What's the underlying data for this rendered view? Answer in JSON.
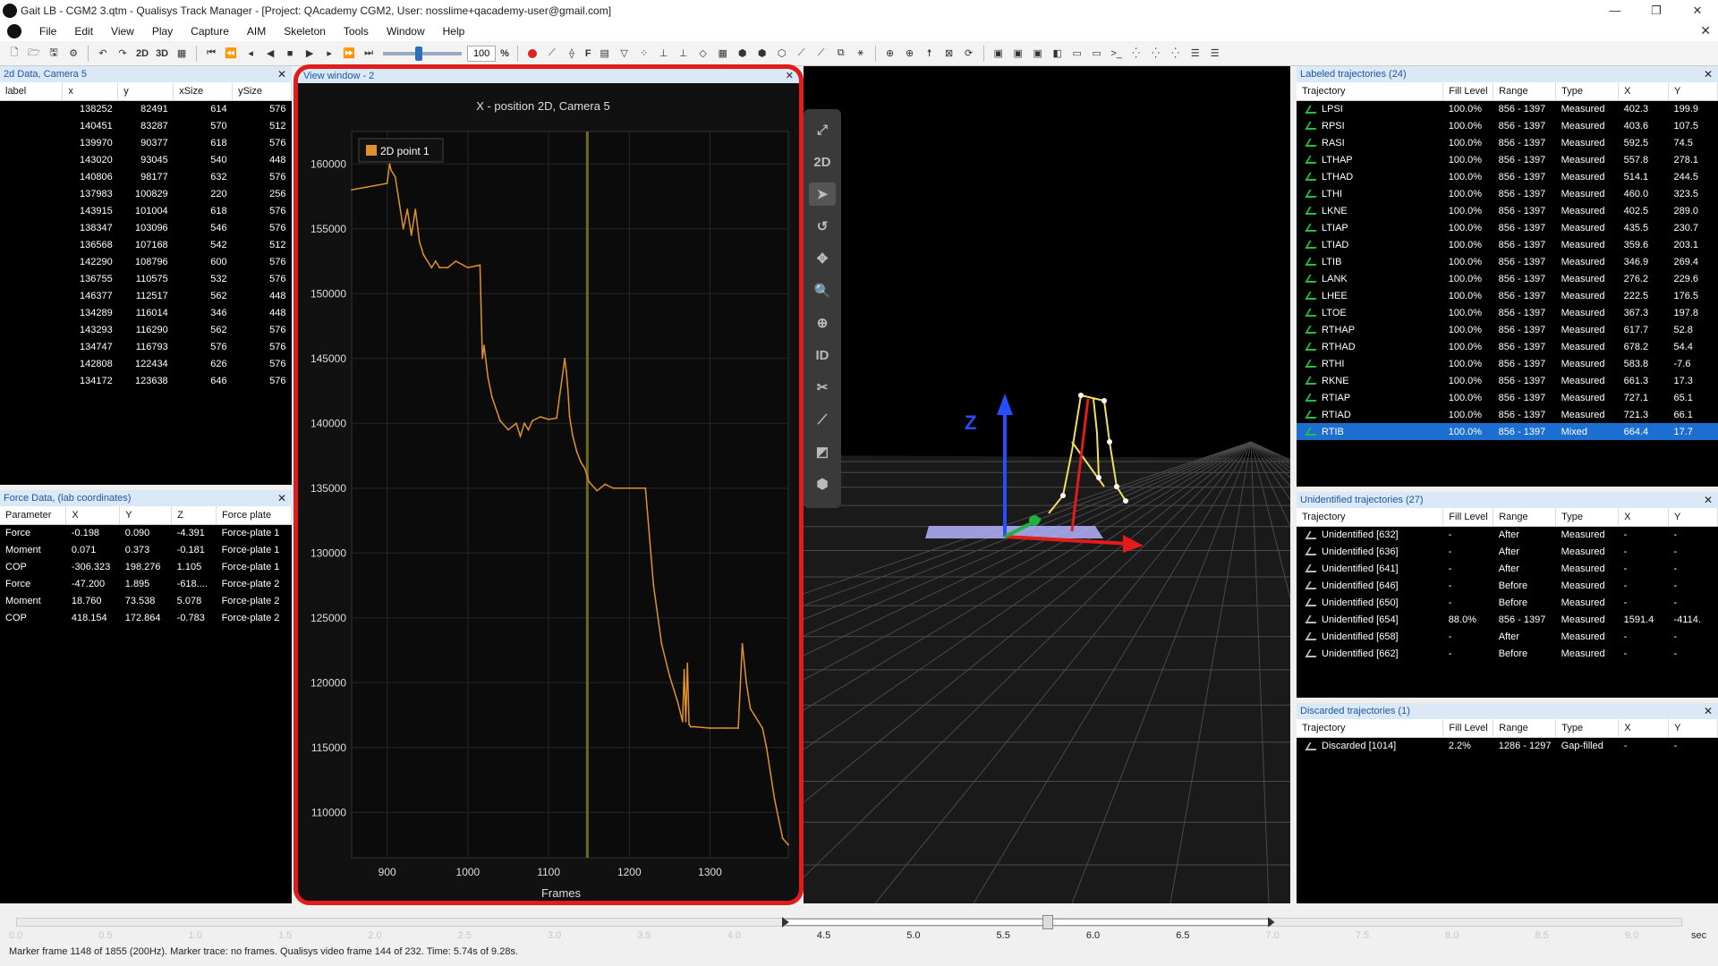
{
  "title": "Gait LB - CGM2 3.qtm - Qualisys Track Manager - [Project: QAcademy CGM2, User: nosslime+qacademy-user@gmail.com]",
  "menu": [
    "File",
    "Edit",
    "View",
    "Play",
    "Capture",
    "AIM",
    "Skeleton",
    "Tools",
    "Window",
    "Help"
  ],
  "toolbar": {
    "btn_2d": "2D",
    "btn_3d": "3D",
    "speed": "100",
    "percent": "%",
    "btn_f": "F"
  },
  "data2d": {
    "title": "2d Data, Camera 5",
    "columns": [
      "label",
      "x",
      "y",
      "xSize",
      "ySize"
    ],
    "rows": [
      [
        "",
        "138252",
        "82491",
        "614",
        "576"
      ],
      [
        "",
        "140451",
        "83287",
        "570",
        "512"
      ],
      [
        "",
        "139970",
        "90377",
        "618",
        "576"
      ],
      [
        "",
        "143020",
        "93045",
        "540",
        "448"
      ],
      [
        "",
        "140806",
        "98177",
        "632",
        "576"
      ],
      [
        "",
        "137983",
        "100829",
        "220",
        "256"
      ],
      [
        "",
        "143915",
        "101004",
        "618",
        "576"
      ],
      [
        "",
        "138347",
        "103096",
        "546",
        "576"
      ],
      [
        "",
        "136568",
        "107168",
        "542",
        "512"
      ],
      [
        "",
        "142290",
        "108796",
        "600",
        "576"
      ],
      [
        "",
        "136755",
        "110575",
        "532",
        "576"
      ],
      [
        "",
        "146377",
        "112517",
        "562",
        "448"
      ],
      [
        "",
        "134289",
        "116014",
        "346",
        "448"
      ],
      [
        "",
        "143293",
        "116290",
        "562",
        "576"
      ],
      [
        "",
        "134747",
        "116793",
        "576",
        "576"
      ],
      [
        "",
        "142808",
        "122434",
        "626",
        "576"
      ],
      [
        "",
        "134172",
        "123638",
        "646",
        "576"
      ]
    ]
  },
  "force": {
    "title": "Force Data,  (lab coordinates)",
    "columns": [
      "Parameter",
      "X",
      "Y",
      "Z",
      "Force plate"
    ],
    "rows": [
      [
        "Force",
        "-0.198",
        "0.090",
        "-4.391",
        "Force-plate 1"
      ],
      [
        "Moment",
        "0.071",
        "0.373",
        "-0.181",
        "Force-plate 1"
      ],
      [
        "COP",
        "-306.323",
        "198.276",
        "1.105",
        "Force-plate 1"
      ],
      [
        "Force",
        "-47.200",
        "1.895",
        "-618....",
        "Force-plate 2"
      ],
      [
        "Moment",
        "18.760",
        "73.538",
        "5.078",
        "Force-plate 2"
      ],
      [
        "COP",
        "418.154",
        "172.864",
        "-0.783",
        "Force-plate 2"
      ]
    ]
  },
  "graph_window": {
    "title": "View window - 2"
  },
  "chart_data": {
    "type": "line",
    "title": "X - position 2D, Camera 5",
    "xlabel": "Frames",
    "ylabel": "",
    "xlim": [
      856,
      1397
    ],
    "ylim": [
      106500,
      162500
    ],
    "xticks": [
      900,
      1000,
      1100,
      1200,
      1300
    ],
    "yticks": [
      110000,
      115000,
      120000,
      125000,
      130000,
      135000,
      140000,
      145000,
      150000,
      155000,
      160000
    ],
    "cursor_frame": 1148,
    "grid": true,
    "legend_position": "top-left",
    "series": [
      {
        "name": "2D point 1",
        "color": "#e0922a",
        "x": [
          856,
          900,
          903,
          905,
          910,
          915,
          920,
          925,
          930,
          935,
          940,
          945,
          950,
          955,
          960,
          965,
          975,
          985,
          1000,
          1015,
          1018,
          1020,
          1025,
          1030,
          1040,
          1050,
          1060,
          1065,
          1070,
          1075,
          1080,
          1090,
          1100,
          1110,
          1120,
          1122,
          1124,
          1126,
          1130,
          1135,
          1140,
          1145,
          1150,
          1160,
          1170,
          1180,
          1200,
          1220,
          1230,
          1240,
          1250,
          1260,
          1266,
          1268,
          1270,
          1272,
          1274,
          1276,
          1280,
          1300,
          1320,
          1335,
          1340,
          1345,
          1350,
          1355,
          1360,
          1365,
          1370,
          1375,
          1380,
          1385,
          1390,
          1397
        ],
        "y": [
          158000,
          158500,
          160000,
          159500,
          159000,
          157000,
          155000,
          156500,
          154500,
          156500,
          154000,
          153000,
          152500,
          152000,
          152500,
          152000,
          152000,
          152500,
          152000,
          152200,
          145000,
          146000,
          143500,
          142000,
          140200,
          139500,
          140000,
          139000,
          140000,
          139500,
          140200,
          140500,
          140300,
          140400,
          145000,
          144000,
          142500,
          140500,
          139000,
          137800,
          137000,
          136500,
          135500,
          134800,
          135300,
          135000,
          135000,
          135000,
          127500,
          123000,
          120500,
          118500,
          117000,
          121000,
          117000,
          121500,
          116800,
          116600,
          116600,
          116500,
          116500,
          116500,
          123000,
          120000,
          118000,
          117500,
          117000,
          116500,
          115000,
          113000,
          111000,
          109500,
          108000,
          107500
        ]
      }
    ]
  },
  "tools": [
    "2D",
    "ID"
  ],
  "view3d": {
    "axis_label": "Z"
  },
  "labeled": {
    "title": "Labeled trajectories (24)",
    "columns": [
      "Trajectory",
      "Fill Level",
      "Range",
      "Type",
      "X",
      "Y"
    ],
    "rows": [
      [
        "LPSI",
        "100.0%",
        "856 - 1397",
        "Measured",
        "402.3",
        "199.9"
      ],
      [
        "RPSI",
        "100.0%",
        "856 - 1397",
        "Measured",
        "403.6",
        "107.5"
      ],
      [
        "RASI",
        "100.0%",
        "856 - 1397",
        "Measured",
        "592.5",
        "74.5"
      ],
      [
        "LTHAP",
        "100.0%",
        "856 - 1397",
        "Measured",
        "557.8",
        "278.1"
      ],
      [
        "LTHAD",
        "100.0%",
        "856 - 1397",
        "Measured",
        "514.1",
        "244.5"
      ],
      [
        "LTHI",
        "100.0%",
        "856 - 1397",
        "Measured",
        "460.0",
        "323.5"
      ],
      [
        "LKNE",
        "100.0%",
        "856 - 1397",
        "Measured",
        "402.5",
        "289.0"
      ],
      [
        "LTIAP",
        "100.0%",
        "856 - 1397",
        "Measured",
        "435.5",
        "230.7"
      ],
      [
        "LTIAD",
        "100.0%",
        "856 - 1397",
        "Measured",
        "359.6",
        "203.1"
      ],
      [
        "LTIB",
        "100.0%",
        "856 - 1397",
        "Measured",
        "346.9",
        "269.4"
      ],
      [
        "LANK",
        "100.0%",
        "856 - 1397",
        "Measured",
        "276.2",
        "229.6"
      ],
      [
        "LHEE",
        "100.0%",
        "856 - 1397",
        "Measured",
        "222.5",
        "176.5"
      ],
      [
        "LTOE",
        "100.0%",
        "856 - 1397",
        "Measured",
        "367.3",
        "197.8"
      ],
      [
        "RTHAP",
        "100.0%",
        "856 - 1397",
        "Measured",
        "617.7",
        "52.8"
      ],
      [
        "RTHAD",
        "100.0%",
        "856 - 1397",
        "Measured",
        "678.2",
        "54.4"
      ],
      [
        "RTHI",
        "100.0%",
        "856 - 1397",
        "Measured",
        "583.8",
        "-7.6"
      ],
      [
        "RKNE",
        "100.0%",
        "856 - 1397",
        "Measured",
        "661.3",
        "17.3"
      ],
      [
        "RTIAP",
        "100.0%",
        "856 - 1397",
        "Measured",
        "727.1",
        "65.1"
      ],
      [
        "RTIAD",
        "100.0%",
        "856 - 1397",
        "Measured",
        "721.3",
        "66.1"
      ],
      [
        "RTIB",
        "100.0%",
        "856 - 1397",
        "Mixed",
        "664.4",
        "17.7"
      ]
    ]
  },
  "unidentified": {
    "title": "Unidentified trajectories (27)",
    "columns": [
      "Trajectory",
      "Fill Level",
      "Range",
      "Type",
      "X",
      "Y"
    ],
    "rows": [
      [
        "Unidentified [632]",
        "-",
        "After",
        "Measured",
        "-",
        "-"
      ],
      [
        "Unidentified [636]",
        "-",
        "After",
        "Measured",
        "-",
        "-"
      ],
      [
        "Unidentified [641]",
        "-",
        "After",
        "Measured",
        "-",
        "-"
      ],
      [
        "Unidentified [646]",
        "-",
        "Before",
        "Measured",
        "-",
        "-"
      ],
      [
        "Unidentified [650]",
        "-",
        "Before",
        "Measured",
        "-",
        "-"
      ],
      [
        "Unidentified [654]",
        "88.0%",
        "856 - 1397",
        "Measured",
        "1591.4",
        "-4114."
      ],
      [
        "Unidentified [658]",
        "-",
        "After",
        "Measured",
        "-",
        "-"
      ],
      [
        "Unidentified [662]",
        "-",
        "Before",
        "Measured",
        "-",
        "-"
      ]
    ]
  },
  "discarded": {
    "title": "Discarded trajectories (1)",
    "columns": [
      "Trajectory",
      "Fill Level",
      "Range",
      "Type",
      "X",
      "Y"
    ],
    "rows": [
      [
        "Discarded [1014]",
        "2.2%",
        "1286 - 1297",
        "Gap-filled",
        "-",
        "-"
      ]
    ]
  },
  "timeline": {
    "labels": [
      "0.0",
      "0.5",
      "1.0",
      "1.5",
      "2.0",
      "2.5",
      "3.0",
      "3.5",
      "4.0",
      "4.5",
      "5.0",
      "5.5",
      "6.0",
      "6.5",
      "7.0",
      "7.5",
      "8.0",
      "8.5",
      "9.0"
    ],
    "active_start": 4.28,
    "active_end": 6.985,
    "cursor": 5.74,
    "duration": 9.28,
    "unit": "sec"
  },
  "status": "Marker frame 1148 of 1855 (200Hz). Marker trace: no frames. Qualisys video frame 144 of 232. Time: 5.74s of 9.28s."
}
